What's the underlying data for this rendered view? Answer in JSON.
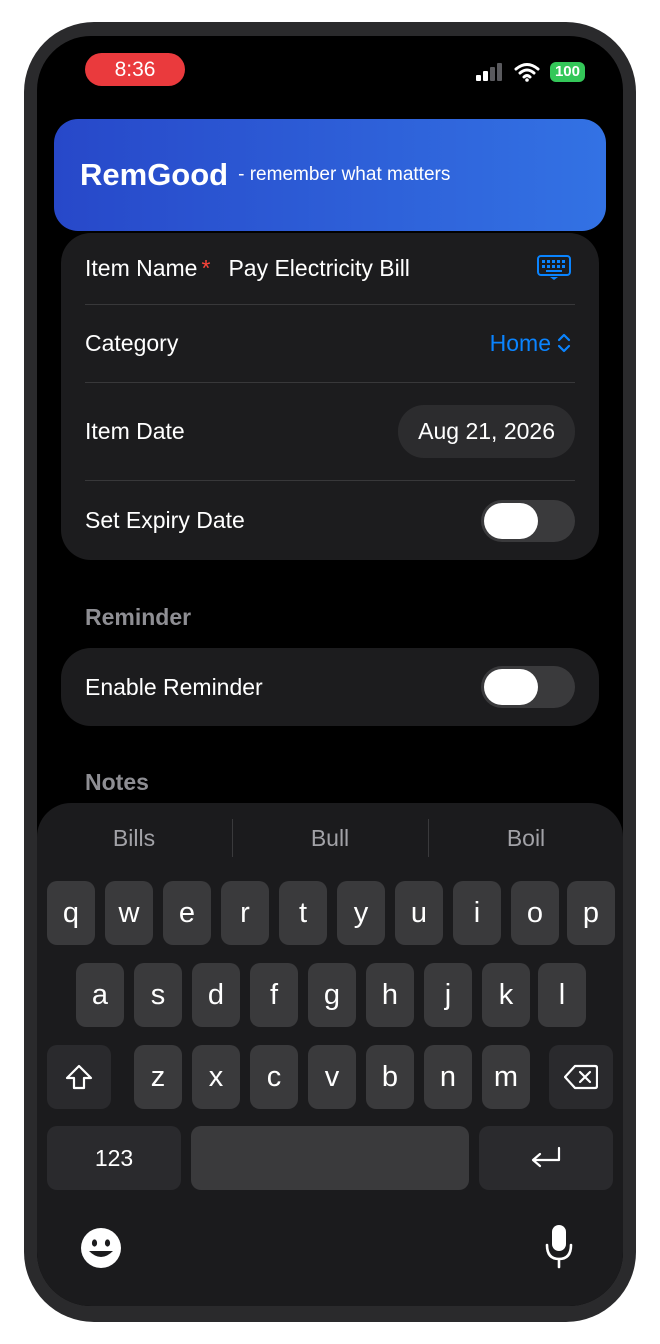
{
  "status": {
    "time": "8:36",
    "battery": "100"
  },
  "header": {
    "title": "RemGood",
    "tagline": "- remember what matters"
  },
  "form": {
    "item_name_label": "Item Name",
    "required_mark": "*",
    "item_name_value": "Pay Electricity Bill",
    "category_label": "Category",
    "category_value": "Home",
    "item_date_label": "Item Date",
    "item_date_value": "Aug 21, 2026",
    "expiry_label": "Set Expiry Date",
    "expiry_enabled": false
  },
  "reminder": {
    "section_title": "Reminder",
    "enable_label": "Enable Reminder",
    "enabled": false
  },
  "notes": {
    "section_title": "Notes"
  },
  "keyboard": {
    "suggestions": [
      "Bills",
      "Bull",
      "Boil"
    ],
    "row1": [
      "q",
      "w",
      "e",
      "r",
      "t",
      "y",
      "u",
      "i",
      "o",
      "p"
    ],
    "row2": [
      "a",
      "s",
      "d",
      "f",
      "g",
      "h",
      "j",
      "k",
      "l"
    ],
    "row3": [
      "z",
      "x",
      "c",
      "v",
      "b",
      "n",
      "m"
    ],
    "numbers_key": "123"
  },
  "colors": {
    "accent": "#0a84ff",
    "header_start": "#2748c9",
    "header_end": "#3372e4",
    "time_pill": "#ea3a3d",
    "battery": "#34c759"
  }
}
